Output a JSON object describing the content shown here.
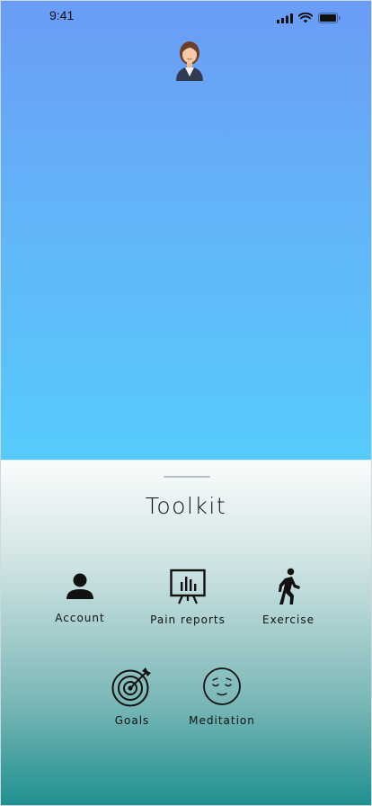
{
  "status_bar": {
    "time": "9:41"
  },
  "sheet": {
    "title": "Toolkit"
  },
  "tools": [
    {
      "label": "Account",
      "icon": "account-icon"
    },
    {
      "label": "Pain reports",
      "icon": "chart-board-icon"
    },
    {
      "label": "Exercise",
      "icon": "walking-icon"
    },
    {
      "label": "Goals",
      "icon": "target-icon"
    },
    {
      "label": "Meditation",
      "icon": "meditation-face-icon"
    }
  ]
}
